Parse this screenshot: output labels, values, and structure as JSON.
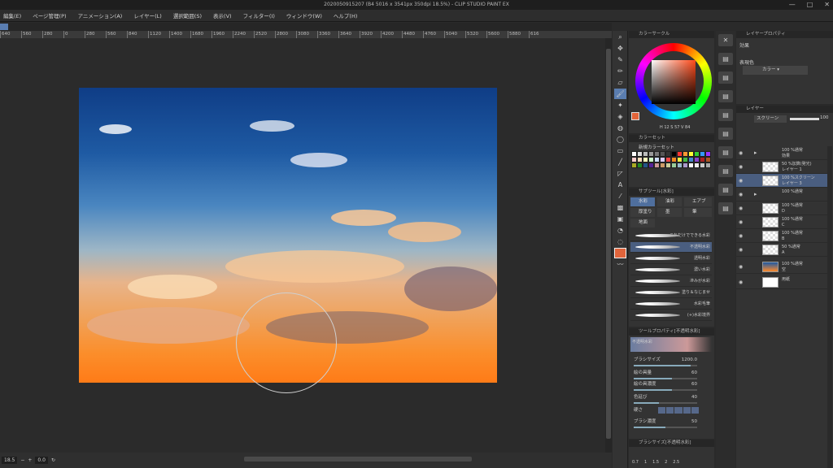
{
  "window": {
    "title": "2020050915207 (B4 5016 x 3541px 350dpi 18.5%) - CLIP STUDIO PAINT EX",
    "controls": [
      "—",
      "□",
      "✕"
    ]
  },
  "menu": [
    "編集(E)",
    "ページ管理(P)",
    "アニメーション(A)",
    "レイヤー(L)",
    "選択範囲(S)",
    "表示(V)",
    "フィルター(I)",
    "ウィンドウ(W)",
    "ヘルプ(H)"
  ],
  "ruler": [
    "640",
    "560",
    "280",
    "0",
    "280",
    "560",
    "840",
    "1120",
    "1400",
    "1680",
    "1960",
    "2240",
    "2520",
    "2800",
    "3080",
    "3360",
    "3640",
    "3920",
    "4200",
    "4480",
    "4760",
    "5040",
    "5320",
    "5600",
    "5880",
    "616"
  ],
  "status": {
    "zoom": "18.5",
    "angle": "0.0"
  },
  "color_wheel": {
    "title": "カラーサークル",
    "readout": "H 12  S 57  V 84",
    "current_color": "#e2643a"
  },
  "color_set": {
    "tab": "カラーセット",
    "set_name": "新規カラーセット"
  },
  "subtool": {
    "title": "サブツール[水彩]",
    "categories": [
      "水彩",
      "油彩",
      "エアブ",
      "厚塗り",
      "墨",
      "筆",
      "地面"
    ],
    "brushes": [
      "これだけでできる水彩",
      "不透明水彩",
      "透明水彩",
      "濃い水彩",
      "滲みが水彩",
      "塗り＆なじませ",
      "水彩毛筆",
      "(+)水彩境界"
    ],
    "selected_brush": "不透明水彩"
  },
  "tool_property": {
    "title": "ツールプロパティ[不透明水彩]",
    "brush_label": "不透明水彩",
    "rows": [
      {
        "label": "ブラシサイズ",
        "value": "1200.0",
        "fill": 0.9
      },
      {
        "label": "絵の具量",
        "value": "60",
        "fill": 0.6
      },
      {
        "label": "絵の具濃度",
        "value": "60",
        "fill": 0.6
      },
      {
        "label": "色延び",
        "value": "40",
        "fill": 0.4
      },
      {
        "label": "硬さ",
        "value": "",
        "fill": 0.5
      },
      {
        "label": "ブラシ濃度",
        "value": "50",
        "fill": 0.5
      }
    ]
  },
  "brush_size": {
    "title": "ブラシサイズ[不透明水彩]",
    "sizes": [
      "0.7",
      "1",
      "1.5",
      "2",
      "2.5"
    ]
  },
  "effects": {
    "title": "レイヤープロパティ",
    "heading": "効果",
    "expr_label": "表現色",
    "expr_value": "カラー"
  },
  "layer": {
    "title": "レイヤー",
    "blend": "スクリーン",
    "opacity": "100",
    "layers": [
      {
        "l1": "100 %通常",
        "l2": "効果",
        "type": "folder",
        "sel": false
      },
      {
        "l1": "50 %加算(発光)",
        "l2": "レイヤー 1",
        "type": "layer",
        "sel": false
      },
      {
        "l1": "100 %スクリーン",
        "l2": "レイヤー 3",
        "type": "layer",
        "sel": true
      },
      {
        "l1": "100 %通常",
        "l2": "",
        "type": "folder",
        "sel": false
      },
      {
        "l1": "100 %通常",
        "l2": "D",
        "type": "layer",
        "sel": false
      },
      {
        "l1": "100 %通常",
        "l2": "C",
        "type": "layer",
        "sel": false
      },
      {
        "l1": "100 %通常",
        "l2": "B",
        "type": "layer",
        "sel": false
      },
      {
        "l1": "50 %通常",
        "l2": "A",
        "type": "layer",
        "sel": false
      },
      {
        "l1": "100 %通常",
        "l2": "空",
        "type": "sky",
        "sel": false
      },
      {
        "l1": "用紙",
        "l2": "",
        "type": "paper",
        "sel": false
      }
    ]
  }
}
